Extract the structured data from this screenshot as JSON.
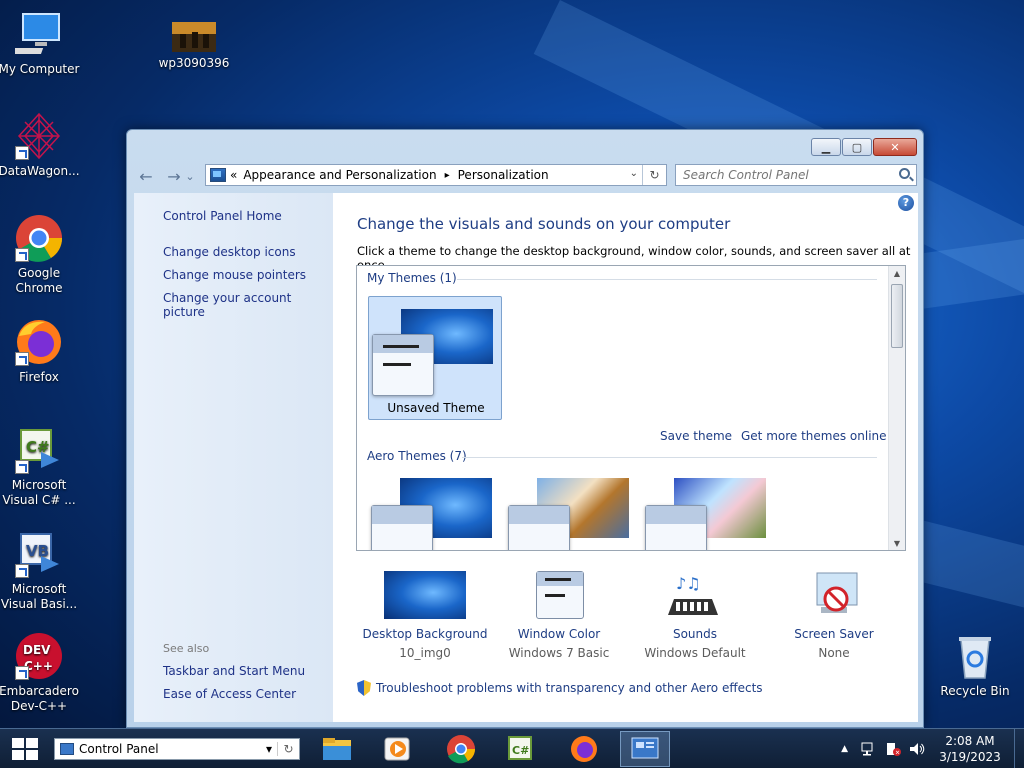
{
  "desktop": {
    "icons": [
      {
        "label": "My Computer"
      },
      {
        "label": "wp3090396"
      },
      {
        "label": "DataWagon..."
      },
      {
        "label": "Google Chrome"
      },
      {
        "label": "Firefox"
      },
      {
        "label": "Microsoft Visual C# ..."
      },
      {
        "label": "Microsoft Visual Basi..."
      },
      {
        "label": "Embarcadero Dev-C++"
      },
      {
        "label": "Recycle Bin"
      }
    ]
  },
  "window": {
    "controls": {
      "minimize": "▁",
      "maximize": "▢",
      "close": "✕"
    },
    "nav": {
      "back": "←",
      "forward": "→",
      "recent": "⌄"
    },
    "breadcrumb": {
      "overflow": "«",
      "items": [
        "Appearance and Personalization",
        "Personalization"
      ],
      "sep": "▸"
    },
    "address_dropdown": "⌄",
    "refresh": "↻",
    "search": {
      "placeholder": "Search Control Panel"
    },
    "left_pane": {
      "home": "Control Panel Home",
      "links": [
        "Change desktop icons",
        "Change mouse pointers",
        "Change your account picture"
      ],
      "see_also_label": "See also",
      "see_also": [
        "Taskbar and Start Menu",
        "Ease of Access Center"
      ]
    },
    "main": {
      "help": "?",
      "title": "Change the visuals and sounds on your computer",
      "description": "Click a theme to change the desktop background, window color, sounds, and screen saver all at once.",
      "my_themes_label": "My Themes (1)",
      "unsaved_theme": "Unsaved Theme",
      "save_theme": "Save theme",
      "get_more": "Get more themes online",
      "aero_themes_label": "Aero Themes (7)",
      "bottom": [
        {
          "label": "Desktop Background",
          "value": "10_img0"
        },
        {
          "label": "Window Color",
          "value": "Windows 7 Basic"
        },
        {
          "label": "Sounds",
          "value": "Windows Default"
        },
        {
          "label": "Screen Saver",
          "value": "None"
        }
      ],
      "troubleshoot": "Troubleshoot problems with transparency and other Aero effects"
    }
  },
  "taskbar": {
    "address": "Control Panel",
    "address_dropdown": "▾",
    "address_refresh": "↻",
    "tray_chevron": "▲",
    "time": "2:08 AM",
    "date": "3/19/2023"
  },
  "colors": {
    "link": "#1e3d84",
    "accent": "#1a66c9"
  }
}
